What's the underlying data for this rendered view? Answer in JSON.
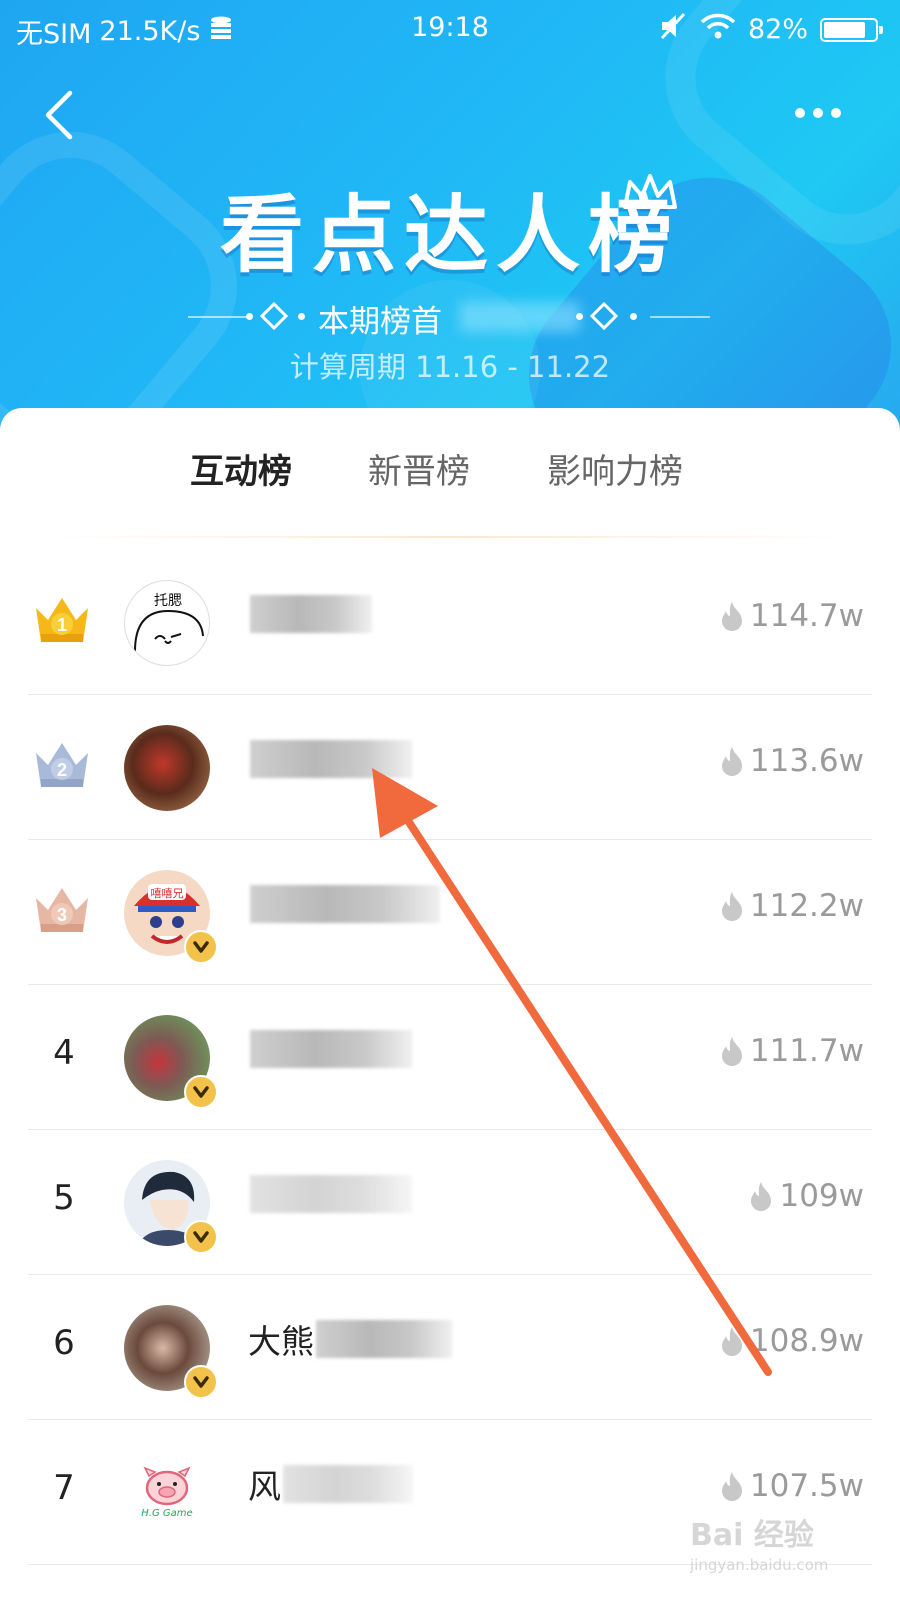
{
  "status_bar": {
    "carrier": "无SIM",
    "speed": "21.5K/s",
    "time": "19:18",
    "battery": "82%"
  },
  "header": {
    "title": "看点达人榜",
    "subtitle_prefix": "本期榜首",
    "period": "计算周期 11.16 - 11.22",
    "colors": {
      "banner": "#20b8f6",
      "text": "#ffffff"
    }
  },
  "tabs": [
    {
      "label": "互动榜",
      "active": true
    },
    {
      "label": "新晋榜",
      "active": false
    },
    {
      "label": "影响力榜",
      "active": false
    }
  ],
  "rankings": [
    {
      "rank": "1",
      "crown": "gold",
      "name_visible": "",
      "score": "114.7w",
      "verified": false
    },
    {
      "rank": "2",
      "crown": "silver",
      "name_visible": "",
      "score": "113.6w",
      "verified": false
    },
    {
      "rank": "3",
      "crown": "bronze",
      "name_visible": "",
      "score": "112.2w",
      "verified": true
    },
    {
      "rank": "4",
      "crown": "",
      "name_visible": "",
      "score": "111.7w",
      "verified": true
    },
    {
      "rank": "5",
      "crown": "",
      "name_visible": "",
      "score": "109w",
      "verified": true
    },
    {
      "rank": "6",
      "crown": "",
      "name_visible": "大熊",
      "score": "108.9w",
      "verified": true
    },
    {
      "rank": "7",
      "crown": "",
      "name_visible": "风",
      "score": "107.5w",
      "verified": false
    }
  ],
  "avatar_1_text": "托腮",
  "avatar_7_text": "H.G Game",
  "avatar_3_text": "嘻嘻兄",
  "watermark": {
    "main": "Bai 经验",
    "sub": "jingyan.baidu.com"
  },
  "icons": {
    "back": "chevron-left-icon",
    "more": "more-dots-icon",
    "score": "flame-icon",
    "verified": "v-badge-icon",
    "wifi": "wifi-icon",
    "mute": "mute-icon"
  }
}
